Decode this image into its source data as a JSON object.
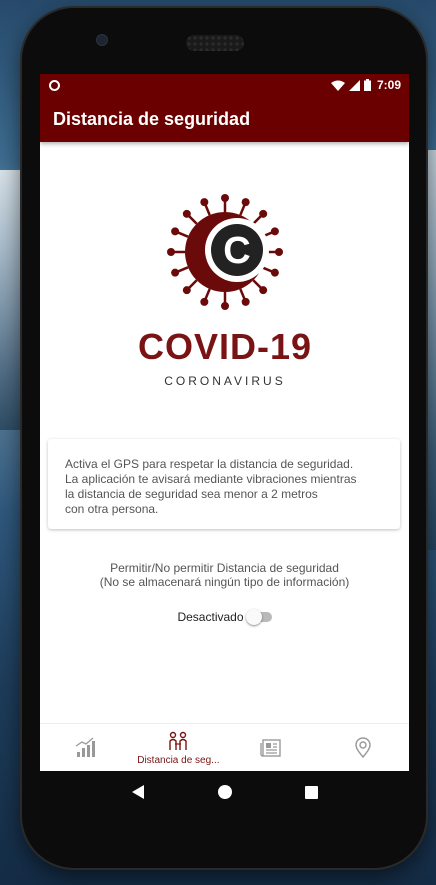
{
  "status_bar": {
    "time": "7:09",
    "icons": [
      "record-dot-icon",
      "wifi-icon",
      "signal-icon",
      "battery-icon"
    ]
  },
  "app_bar": {
    "title": "Distancia de seguridad"
  },
  "logo": {
    "title": "COVID-19",
    "subtitle": "CORONAVIRUS",
    "letter": "C"
  },
  "info_card": {
    "lines": [
      "Activa el GPS para respetar la distancia de seguridad.",
      "La aplicación te avisará mediante vibraciones mientras",
      "la distancia de seguridad sea menor a 2 metros",
      "con otra persona."
    ]
  },
  "permission": {
    "line1": "Permitir/No permitir Distancia de seguridad",
    "line2": "(No se almacenará ningún tipo de información)"
  },
  "toggle": {
    "label": "Desactivado",
    "checked": false
  },
  "bottom_nav": {
    "items": [
      {
        "icon": "stats-chart-icon",
        "label": ""
      },
      {
        "icon": "social-distance-icon",
        "label": "Distancia de seg..."
      },
      {
        "icon": "newspaper-icon",
        "label": ""
      },
      {
        "icon": "location-pin-icon",
        "label": ""
      }
    ],
    "active_index": 1
  },
  "system_nav": {
    "icons": [
      "back-icon",
      "home-icon",
      "recent-apps-icon"
    ]
  },
  "colors": {
    "primary": "#6b0000",
    "logo_red": "#7a1414",
    "text_grey": "#555555"
  }
}
